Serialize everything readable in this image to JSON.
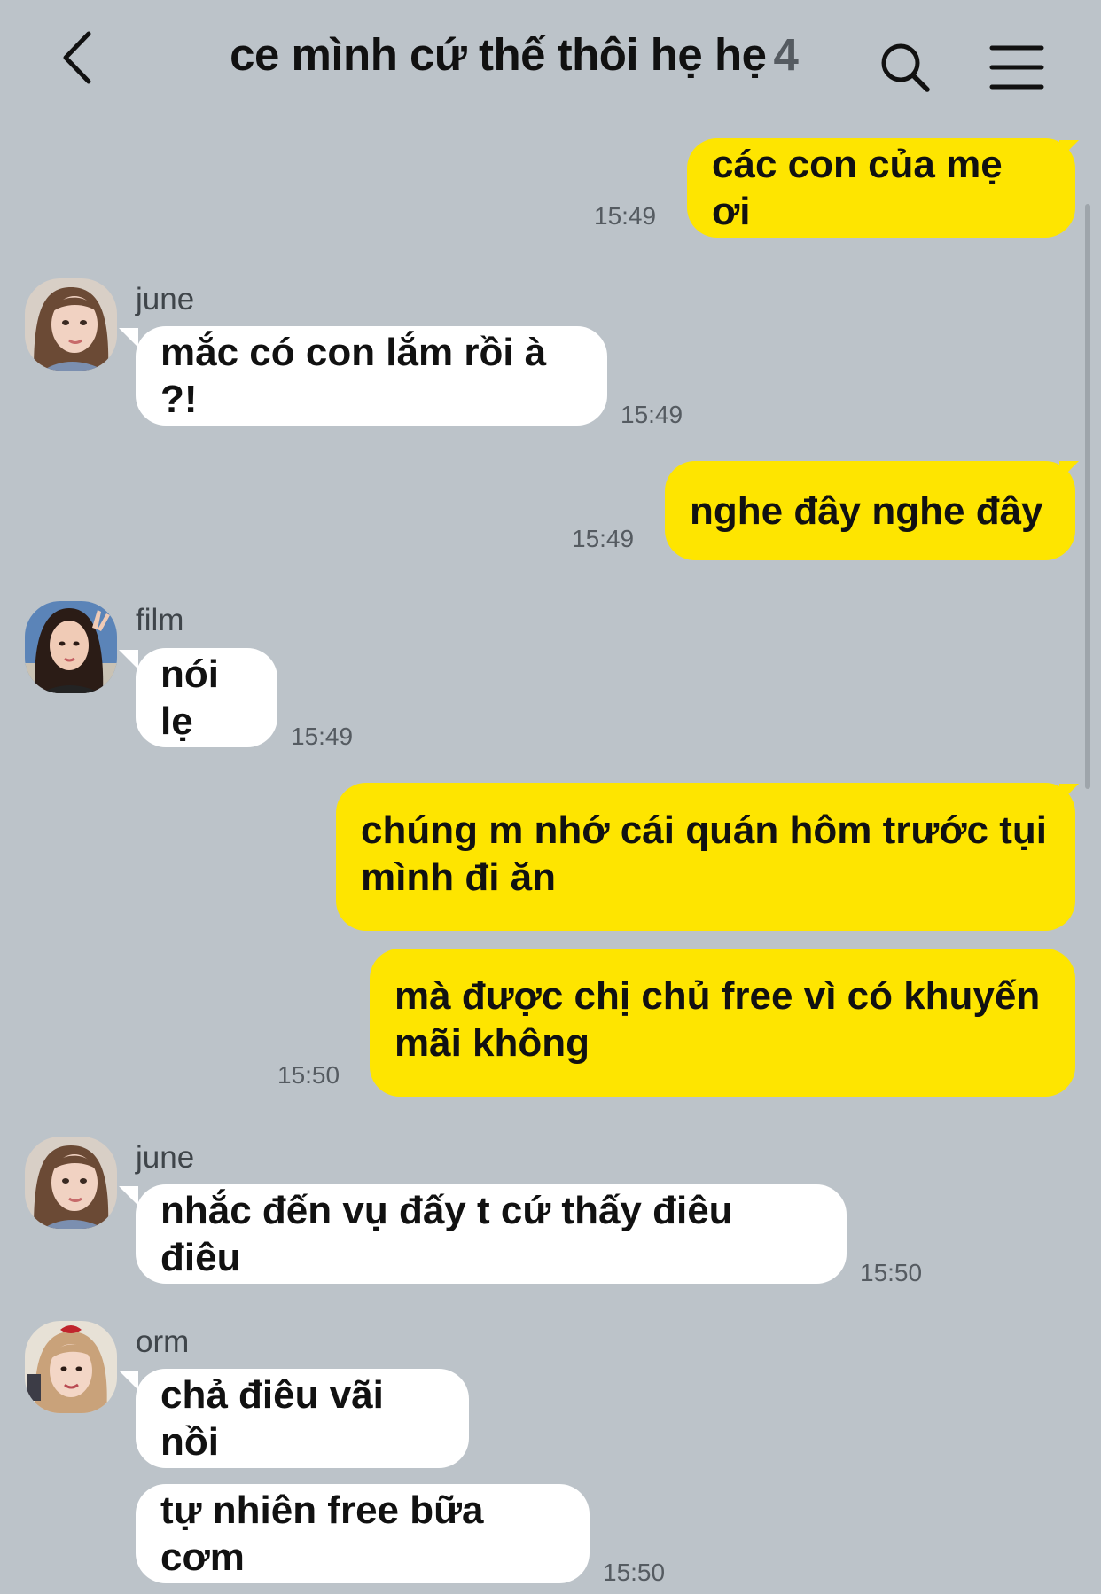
{
  "header": {
    "title": "ce mình cứ thế thôi hẹ hẹ",
    "member_count": "4",
    "back_icon": "chevron-left-icon",
    "search_icon": "search-icon",
    "menu_icon": "hamburger-menu-icon"
  },
  "colors": {
    "background": "#bcc3c9",
    "my_bubble": "#fee500",
    "other_bubble": "#ffffff"
  },
  "messages": [
    {
      "text": "các con của mẹ ơi",
      "time": "15:49"
    },
    {
      "sender": "june",
      "text": "mắc có con lắm rồi à ?!",
      "time": "15:49"
    },
    {
      "text": "nghe đây nghe đây",
      "time": "15:49"
    },
    {
      "sender": "film",
      "text": "nói lẹ",
      "time": "15:49"
    },
    {
      "text_line1": "chúng m nhớ cái quán hôm trước tụi",
      "text_line2": "mình đi ăn"
    },
    {
      "text_line1": "mà được chị chủ free vì có khuyến",
      "text_line2": "mãi không",
      "time": "15:50"
    },
    {
      "sender": "june",
      "text": "nhắc đến vụ đấy t cứ thấy điêu điêu",
      "time": "15:50"
    },
    {
      "sender": "orm",
      "text": "chả điêu vãi nồi"
    },
    {
      "text": "tự nhiên free bữa cơm",
      "time": "15:50"
    }
  ]
}
